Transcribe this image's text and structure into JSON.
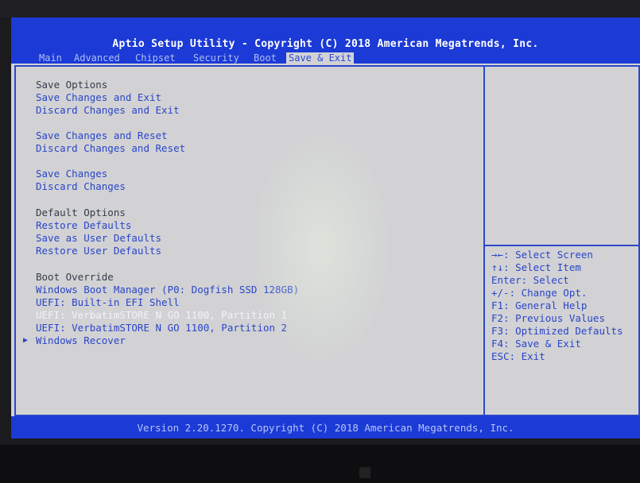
{
  "header": {
    "title": "Aptio Setup Utility - Copyright (C) 2018 American Megatrends, Inc.",
    "tabs": [
      {
        "label": "Main",
        "active": false
      },
      {
        "label": "Advanced",
        "active": false
      },
      {
        "label": "Chipset",
        "active": false
      },
      {
        "label": "Security",
        "active": false
      },
      {
        "label": "Boot",
        "active": false
      },
      {
        "label": "Save & Exit",
        "active": true
      }
    ]
  },
  "menu": {
    "save_options_heading": "Save Options",
    "save_changes_and_exit": "Save Changes and Exit",
    "discard_changes_and_exit": "Discard Changes and Exit",
    "save_changes_and_reset": "Save Changes and Reset",
    "discard_changes_and_reset": "Discard Changes and Reset",
    "save_changes": "Save Changes",
    "discard_changes": "Discard Changes",
    "default_options_heading": "Default Options",
    "restore_defaults": "Restore Defaults",
    "save_as_user_defaults": "Save as User Defaults",
    "restore_user_defaults": "Restore User Defaults",
    "boot_override_heading": "Boot Override",
    "boot_windows_boot_manager": "Windows Boot Manager (P0: Dogfish SSD 128GB)",
    "boot_uefi_shell": "UEFI: Built-in EFI Shell",
    "boot_verbatim_p1": "UEFI: VerbatimSTORE N GO 1100, Partition 1",
    "boot_verbatim_p2": "UEFI: VerbatimSTORE N GO 1100, Partition 2",
    "windows_recover": "Windows Recover"
  },
  "help": {
    "lines": [
      "→←: Select Screen",
      "↑↓: Select Item",
      "Enter: Select",
      "+/-: Change Opt.",
      "F1: General Help",
      "F2: Previous Values",
      "F3: Optimized Defaults",
      "F4: Save & Exit",
      "ESC: Exit"
    ]
  },
  "footer": {
    "version": "Version 2.20.1270. Copyright (C) 2018 American Megatrends, Inc."
  },
  "colors": {
    "bar_blue": "#1b3ad6",
    "item_blue": "#2a45c9",
    "panel_gray": "#d2d2d4"
  },
  "icons": {
    "submenu_arrow": "triangle-right-icon"
  }
}
